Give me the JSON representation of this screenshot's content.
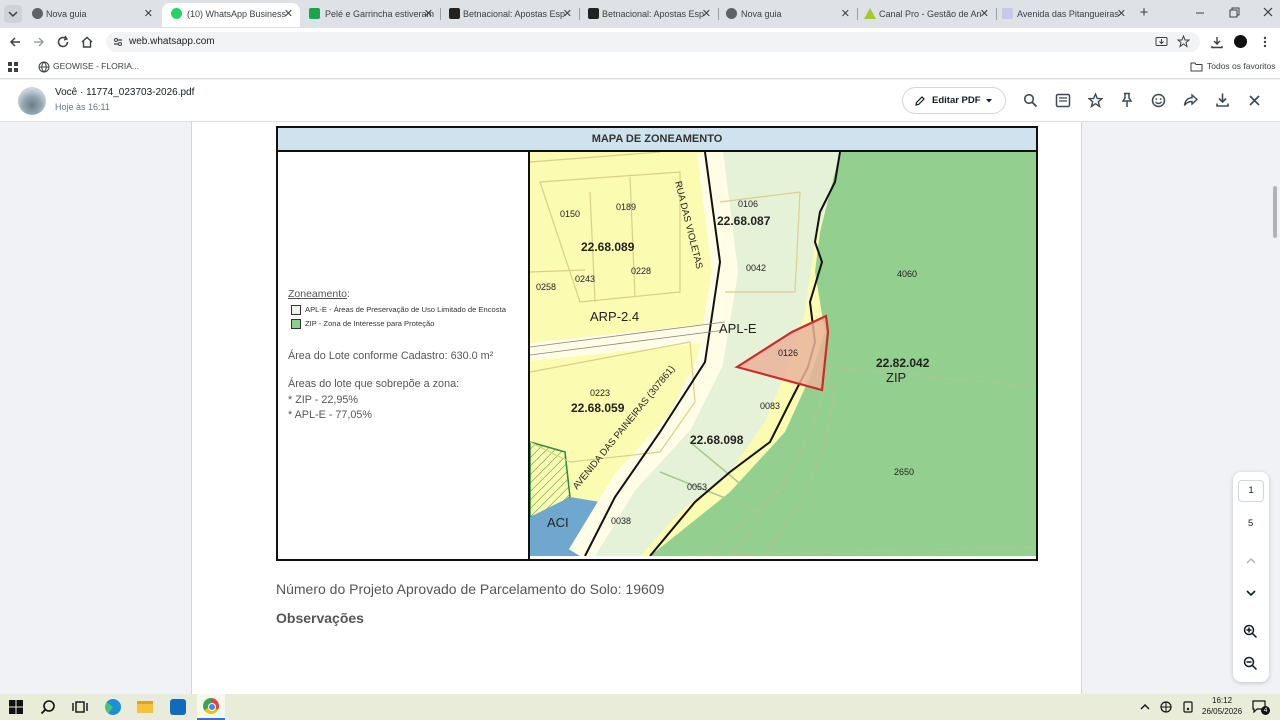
{
  "tabs": [
    {
      "label": "Nova guia",
      "icon": "chrome-icon"
    },
    {
      "label": "(10) WhatsApp Business",
      "icon": "whatsapp-icon"
    },
    {
      "label": "Pelé e Garrincha estiveram",
      "icon": "ge-icon"
    },
    {
      "label": "Betnacional: Apostas Esp",
      "icon": "betnacional-icon"
    },
    {
      "label": "Betnacional: Apostas Esp",
      "icon": "betnacional-icon"
    },
    {
      "label": "Nova guia",
      "icon": "chrome-icon"
    },
    {
      "label": "Canal Pro - Gestão de An",
      "icon": "canalpro-icon"
    },
    {
      "label": "Avenida das Pitangueiras",
      "icon": "doc-icon"
    }
  ],
  "address": "web.whatsapp.com",
  "bookmarks": {
    "item": "GEOWISE - FLORIA...",
    "favorites": "Todos os favoritos"
  },
  "viewer": {
    "sender": "Você · 11774_023703-2026.pdf",
    "time": "Hoje às 16:11",
    "edit_pdf": "Editar PDF"
  },
  "map": {
    "header": "MAPA DE ZONEAMENTO",
    "legend_title": "Zoneamento",
    "legend_items": [
      {
        "label": "APL-E - Áreas de Preservação de Uso Limitado de Encosta",
        "color": "#eef6e4"
      },
      {
        "label": "ZIP - Zona de Interesse para Proteção",
        "color": "#8fcf8c"
      }
    ],
    "area_text": "Área do Lote conforme Cadastro: 630.0 m²",
    "overlap_title": "Áreas do lote que sobrepõe a zona:",
    "overlap_items": [
      "* ZIP - 22,95%",
      "* APL-E - 77,05%"
    ],
    "labels": {
      "l0150": "0150",
      "l0189": "0189",
      "l0106": "0106",
      "q087": "22.68.087",
      "q089": "22.68.089",
      "l0243": "0243",
      "l0228": "0228",
      "l0042": "0042",
      "l4060": "4060",
      "l0258": "0258",
      "arp": "ARP-2.4",
      "aple": "APL-E",
      "l0126": "0126",
      "q042": "22.82.042",
      "zip": "ZIP",
      "l0223": "0223",
      "q059": "22.68.059",
      "l0083": "0083",
      "q098": "22.68.098",
      "l2650": "2650",
      "l0053": "0053",
      "l0038": "0038",
      "aci": "ACI",
      "rua": "RUA DAS VIOLETAS",
      "avenida": "AVENIDA DAS PAINEIRAS (307861)"
    }
  },
  "doc": {
    "project": "Número do Projeto Aprovado de Parcelamento do Solo: 19609",
    "observacoes": "Observações"
  },
  "pager": {
    "current": "1",
    "total": "5"
  },
  "taskbar": {
    "time": "16:12",
    "date": "26/05/2026",
    "badge": "4"
  }
}
